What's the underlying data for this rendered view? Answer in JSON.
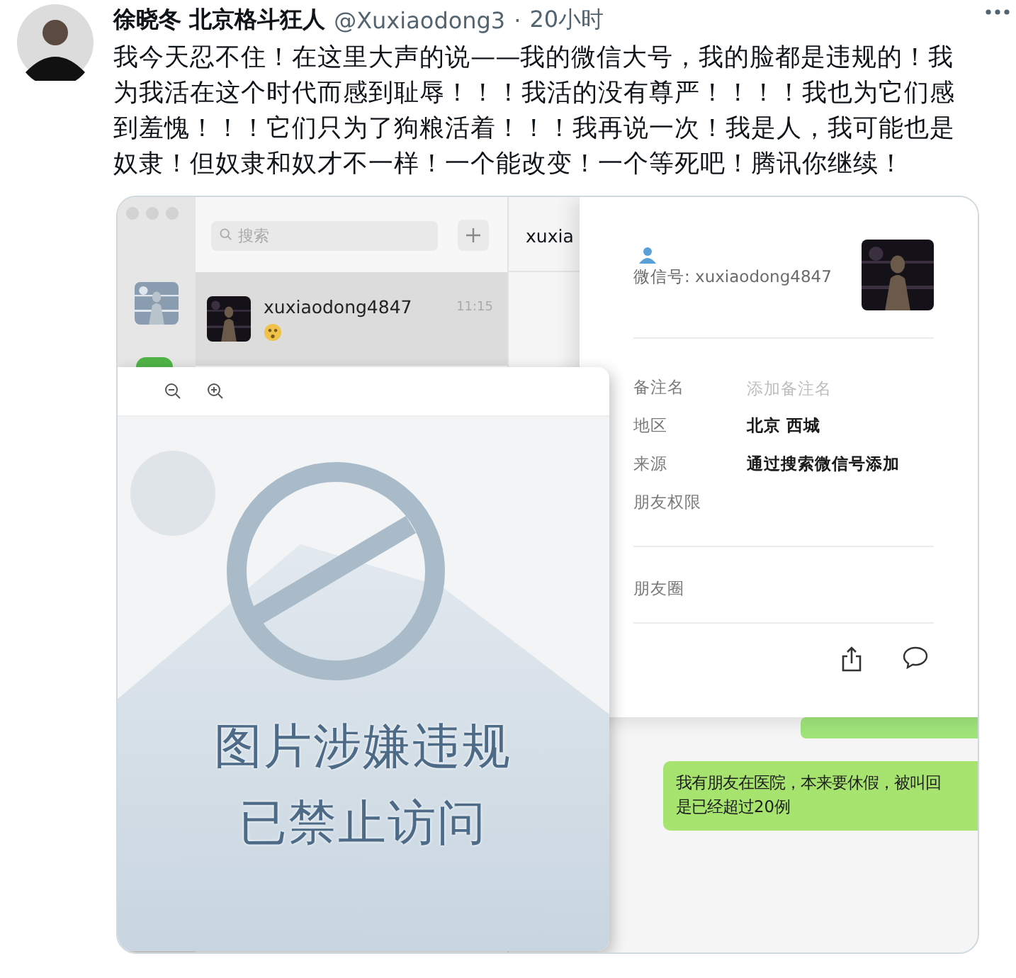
{
  "tweet": {
    "author": "徐晓冬 北京格斗狂人",
    "handle": "@Xuxiaodong3",
    "separator": "·",
    "time": "20小时",
    "text": "我今天忍不住！在这里大声的说——我的微信大号，我的脸都是违规的！我为我活在这个时代而感到耻辱！！！我活的没有尊严！！！！我也为它们感到羞愧！！！它们只为了狗粮活着！！！我再说一次！我是人，我可能也是奴隶！但奴隶和奴才不一样！一个能改变！一个等死吧！腾讯你继续！"
  },
  "screenshot": {
    "search": {
      "placeholder": "搜索"
    },
    "chats": [
      {
        "name": "xuxiaodong4847",
        "time": "11:15",
        "selected": true
      }
    ],
    "chat_title": "xuxia",
    "profile": {
      "wechat_id": "微信号: xuxiaodong4847",
      "fields": [
        {
          "label": "备注名",
          "placeholder": "添加备注名",
          "kind": "input"
        },
        {
          "label": "地区",
          "value": "北京 西城",
          "kind": "value"
        },
        {
          "label": "来源",
          "value": "通过搜索微信号添加",
          "kind": "value"
        },
        {
          "label": "朋友权限",
          "kind": "empty"
        }
      ],
      "moments": "朋友圈"
    },
    "messages": [
      {
        "lines": [
          "我有朋友在医院，本来要休假，被叫回",
          "是已经超过20例"
        ]
      }
    ],
    "viewer": {
      "notice": [
        "图片涉嫌违规",
        "已禁止访问"
      ]
    }
  }
}
